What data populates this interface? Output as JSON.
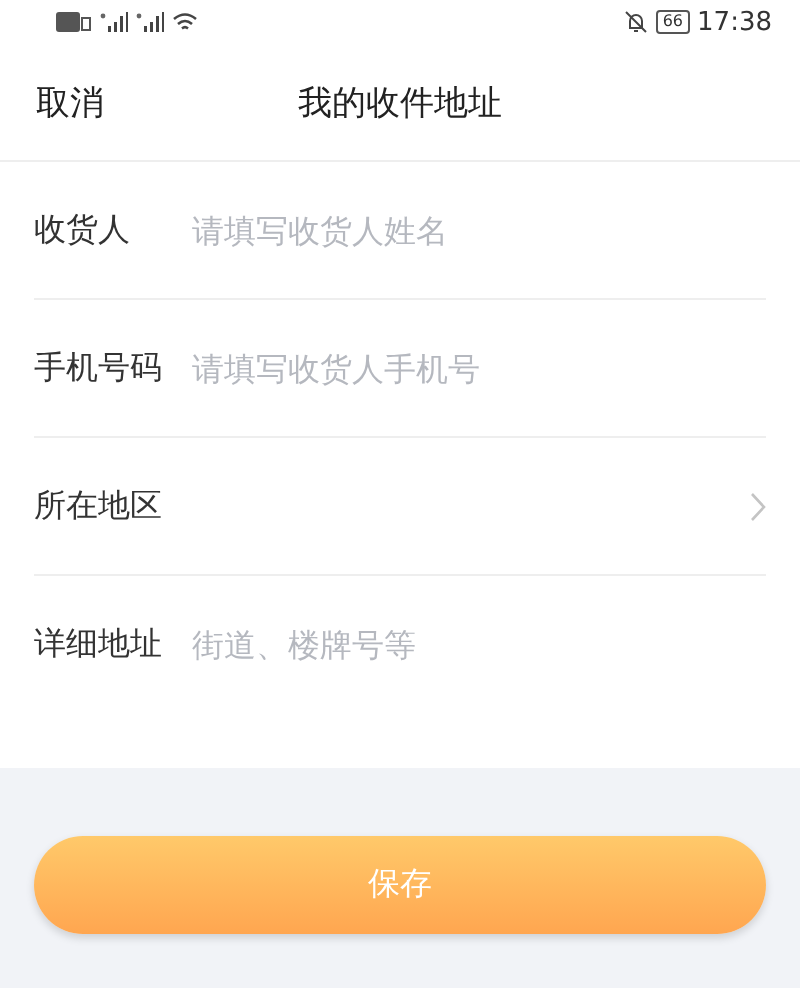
{
  "status_bar": {
    "battery": "66",
    "time": "17:38"
  },
  "nav": {
    "cancel": "取消",
    "title": "我的收件地址"
  },
  "fields": [
    {
      "kind": "input",
      "label": "收货人",
      "placeholder": "请填写收货人姓名"
    },
    {
      "kind": "input",
      "label": "手机号码",
      "placeholder": "请填写收货人手机号"
    },
    {
      "kind": "select",
      "label": "所在地区"
    },
    {
      "kind": "input",
      "label": "详细地址",
      "placeholder": "街道、楼牌号等"
    }
  ],
  "save_button": "保存"
}
